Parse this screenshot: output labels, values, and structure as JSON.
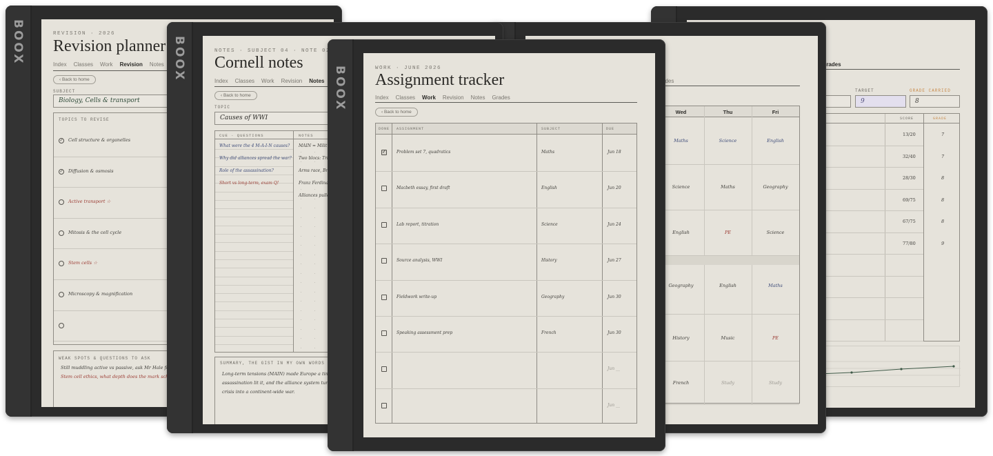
{
  "brand": "BOOX",
  "revision": {
    "eyebrow": "REVISION · 2026",
    "title": "Revision planner",
    "tabs": [
      "Index",
      "Classes",
      "Work",
      "Revision",
      "Notes"
    ],
    "active_tab": "Revision",
    "back": "‹ Back to home",
    "subject_label": "SUBJECT",
    "subject_value": "Biology, Cells & transport",
    "topics_label": "TOPICS TO REVISE",
    "topics": [
      {
        "text": "Cell structure & organelles",
        "state": "done"
      },
      {
        "text": "Diffusion & osmosis",
        "state": "done"
      },
      {
        "text": "Active transport ☆",
        "state": "star"
      },
      {
        "text": "Mitosis & the cell cycle",
        "state": "open"
      },
      {
        "text": "Stem cells ☆",
        "state": "star"
      },
      {
        "text": "Microscopy & magnification",
        "state": "open"
      },
      {
        "text": "",
        "state": "open"
      }
    ],
    "weak_label": "WEAK SPOTS & QUESTIONS TO ASK",
    "weak_lines": [
      "Still muddling active vs passive, ask Mr Hale for a d",
      "Stem cell ethics, what depth does the mark scheme w"
    ]
  },
  "grades": {
    "tab_visible": "Grades",
    "target_label": "TARGET",
    "target_value": "9",
    "carried_label": "GRADE CARRIED",
    "carried_value": "8",
    "score_header": "SCORE",
    "grade_header": "GRADE",
    "rows": [
      {
        "score": "13/20",
        "grade": "7"
      },
      {
        "score": "32/40",
        "grade": "7"
      },
      {
        "score": "28/30",
        "grade": "8"
      },
      {
        "score": "69/75",
        "grade": "8"
      },
      {
        "score": "67/75",
        "grade": "8"
      },
      {
        "score": "77/80",
        "grade": "9"
      }
    ]
  },
  "timetable": {
    "tab_visible": "ades",
    "days": [
      "Wed",
      "Thu",
      "Fri"
    ],
    "rows": [
      [
        "Maths",
        "Science",
        "English"
      ],
      [
        "Science",
        "Maths",
        "Geography"
      ],
      [
        "English",
        "PE",
        "Science"
      ],
      [
        "Geography",
        "English",
        "Maths"
      ],
      [
        "History",
        "Music",
        "PE"
      ],
      [
        "French",
        "Study",
        "Study"
      ]
    ]
  },
  "cornell": {
    "eyebrow": "NOTES · SUBJECT 04 · NOTE 02",
    "title": "Cornell notes",
    "tabs": [
      "Index",
      "Classes",
      "Work",
      "Revision",
      "Notes"
    ],
    "active_tab": "Notes",
    "back": "‹ Back to home",
    "topic_label": "TOPIC",
    "topic_value": "Causes of WWI",
    "cue_label": "CUE · QUESTIONS",
    "notes_label": "NOTES",
    "cues": [
      {
        "text": "What were the 4 M-A-I-N causes?",
        "color": "blue"
      },
      {
        "text": "Why did alliances spread the war?",
        "color": "blue"
      },
      {
        "text": "Role of the assassination?",
        "color": "blue"
      },
      {
        "text": "Short vs long-term, exam Q!",
        "color": "red"
      }
    ],
    "notes": [
      "MAIN = Milit",
      "Two blocs: Tri",
      "Arms race, Bri",
      "Franz Ferdina",
      "Alliances pulle"
    ],
    "summary_label": "SUMMARY, THE GIST IN MY OWN WORDS",
    "summary_lines": [
      "Long-term tensions (MAIN) made Europe a tinderb",
      "assassination lit it, and the alliance system turned a",
      "crisis into a continent-wide war."
    ]
  },
  "tracker": {
    "eyebrow": "WORK · JUNE 2026",
    "title": "Assignment tracker",
    "tabs": [
      "Index",
      "Classes",
      "Work",
      "Revision",
      "Notes",
      "Grades"
    ],
    "active_tab": "Work",
    "back": "‹ Back to home",
    "columns": [
      "DONE",
      "ASSIGNMENT",
      "SUBJECT",
      "DUE"
    ],
    "rows": [
      {
        "done": true,
        "assignment": "Problem set 7, quadratics",
        "subject": "Maths",
        "due": "Jun 18"
      },
      {
        "done": false,
        "assignment": "Macbeth essay, first draft",
        "subject": "English",
        "due": "Jun 20"
      },
      {
        "done": false,
        "assignment": "Lab report, titration",
        "subject": "Science",
        "due": "Jun 24"
      },
      {
        "done": false,
        "assignment": "Source analysis, WWI",
        "subject": "History",
        "due": "Jun 27"
      },
      {
        "done": false,
        "assignment": "Fieldwork write-up",
        "subject": "Geography",
        "due": "Jun 30"
      },
      {
        "done": false,
        "assignment": "Speaking assessment prep",
        "subject": "French",
        "due": "Jun 30"
      },
      {
        "done": false,
        "assignment": "",
        "subject": "",
        "due": "Jun __"
      },
      {
        "done": false,
        "assignment": "",
        "subject": "",
        "due": "Jun __"
      }
    ]
  },
  "colors": {
    "bezel": "#2b2b2b",
    "paper": "#e6e3db",
    "ink": "#2b2a27",
    "accent_red": "#9b3b33",
    "accent_blue": "#3c4a78",
    "accent_orange": "#c88a4a",
    "target_fill": "#e3dfee"
  }
}
